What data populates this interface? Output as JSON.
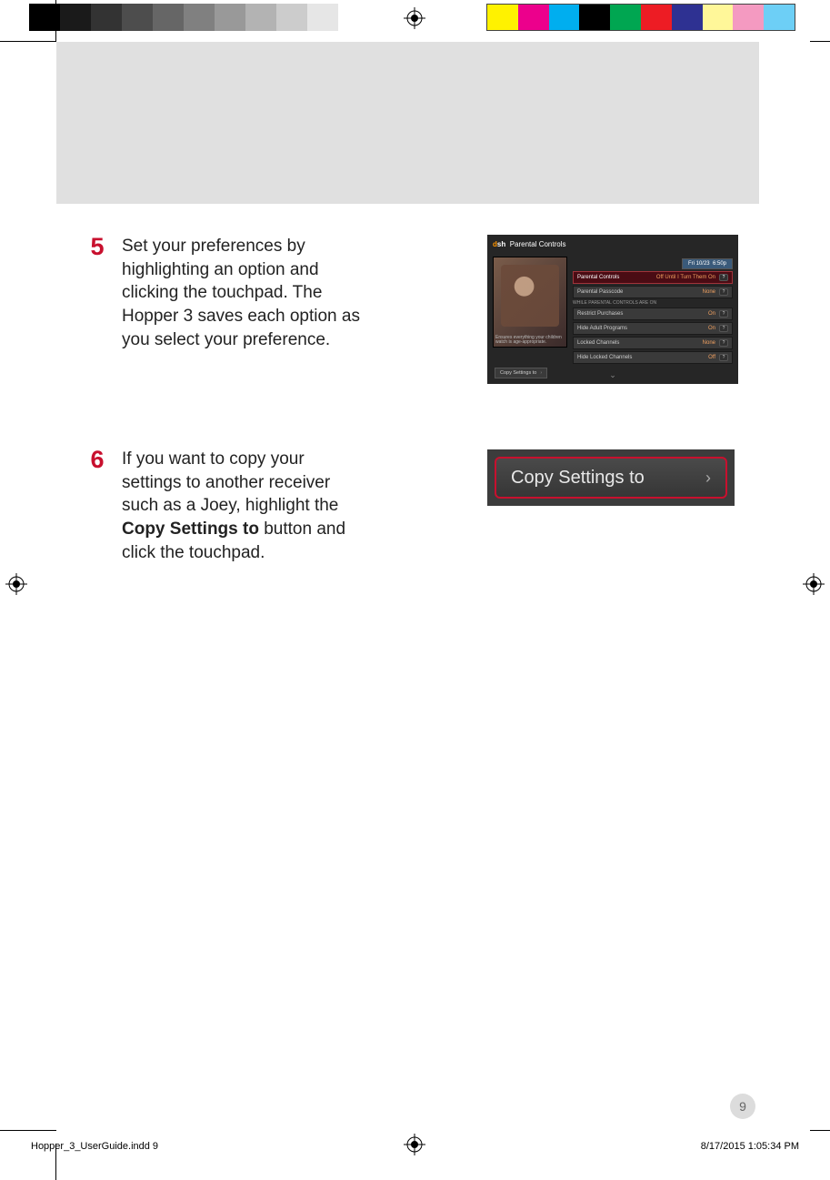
{
  "steps": [
    {
      "num": "5",
      "text_plain": "Set your preferences by highlighting an option and clicking the touchpad. The Hopper 3 saves each option as you select your preference."
    },
    {
      "num": "6",
      "text_before_bold": "If you want to copy your settings to another receiver such as a Joey, highlight the ",
      "text_bold": "Copy Settings to",
      "text_after_bold": " button and click the touchpad."
    }
  ],
  "parental_screenshot": {
    "brand_d": "d",
    "brand_ish": "sh",
    "title": "Parental Controls",
    "date": "Fri 10/23",
    "time": "6:50p",
    "caption": "Ensures everything your children watch is age-appropriate.",
    "sep_label": "WHILE PARENTAL CONTROLS ARE ON",
    "copy_btn_label": "Copy Settings to",
    "rows": [
      {
        "label": "Parental Controls",
        "value": "Off Until I Turn Them On",
        "hl": true
      },
      {
        "label": "Parental Passcode",
        "value": "None"
      },
      {
        "label": "Restrict Purchases",
        "value": "On"
      },
      {
        "label": "Hide Adult Programs",
        "value": "On"
      },
      {
        "label": "Locked Channels",
        "value": "None"
      },
      {
        "label": "Hide Locked Channels",
        "value": "Off"
      }
    ]
  },
  "copy_button": {
    "label": "Copy Settings to"
  },
  "page_number": "9",
  "footer": {
    "file": "Hopper_3_UserGuide.indd   9",
    "date": "8/17/2015   1:05:34 PM"
  }
}
